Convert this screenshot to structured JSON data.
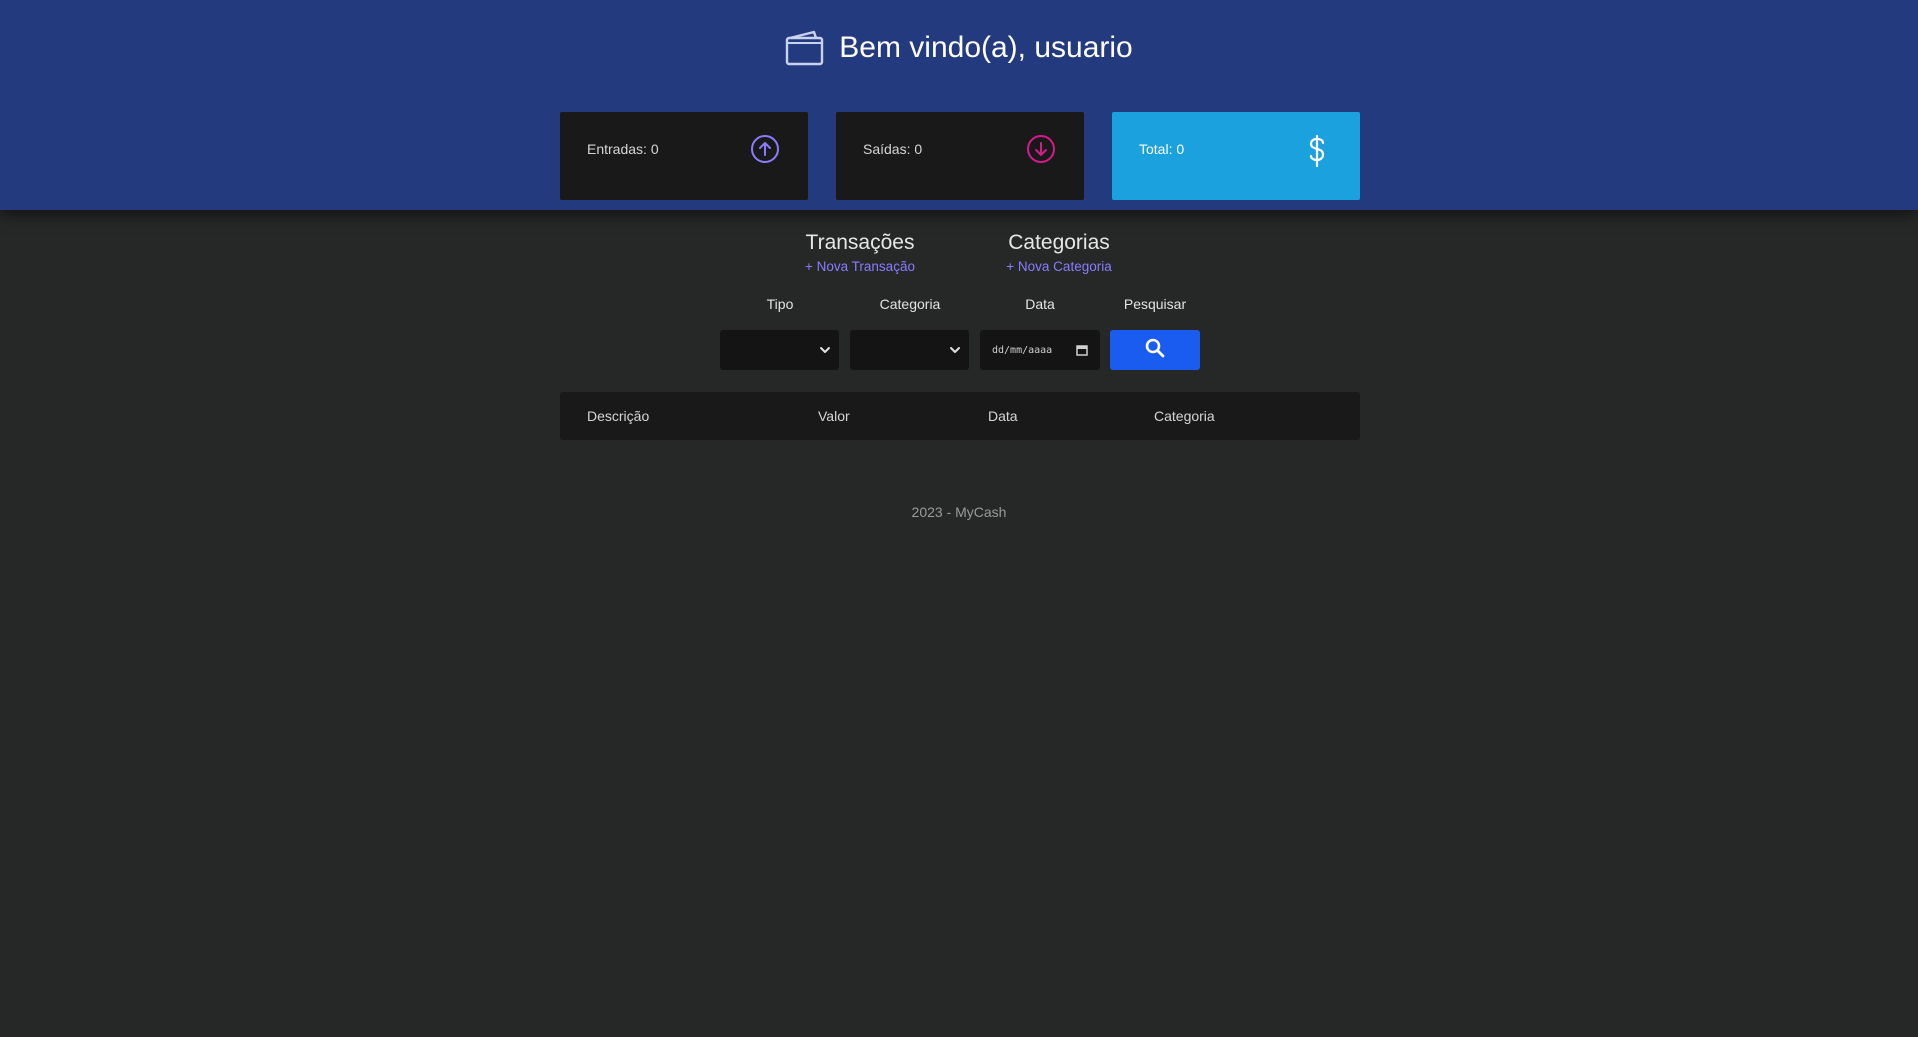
{
  "header": {
    "welcome": "Bem vindo(a), usuario",
    "icon": "wallet-icon",
    "background_color": "#243a7e"
  },
  "summary": {
    "income": {
      "label": "Entradas: 0",
      "icon": "arrow-up-circle-icon",
      "color": "#8a7cff"
    },
    "expenses": {
      "label": "Saídas: 0",
      "icon": "arrow-down-circle-icon",
      "color": "#d41a8c"
    },
    "total": {
      "label": "Total: 0",
      "icon": "dollar-icon",
      "color": "#1aa1de"
    }
  },
  "sections": {
    "transactions": {
      "title": "Transações",
      "link": "+ Nova Transação"
    },
    "categories": {
      "title": "Categorias",
      "link": "+ Nova Categoria"
    }
  },
  "filters": {
    "type_label": "Tipo",
    "category_label": "Categoria",
    "date_label": "Data",
    "search_label": "Pesquisar",
    "date_placeholder": "dd/mm/aaaa",
    "search_button_color": "#1b5cf0"
  },
  "table": {
    "columns": [
      "Descrição",
      "Valor",
      "Data",
      "Categoria"
    ]
  },
  "footer": {
    "text": "2023 - MyCash"
  }
}
